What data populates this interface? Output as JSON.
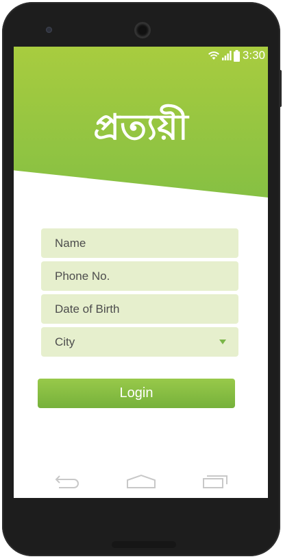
{
  "status_bar": {
    "time": "3:30",
    "icons": [
      "wifi-icon",
      "signal-icon",
      "battery-icon"
    ],
    "color": "#ffffff"
  },
  "header": {
    "app_name": "প্রত্যয়ী",
    "gradient": [
      "#a8cc3f",
      "#86c043"
    ]
  },
  "form": {
    "name_placeholder": "Name",
    "phone_placeholder": "Phone No.",
    "dob_placeholder": "Date of Birth",
    "city_value": "City",
    "field_color": "#e6efcd"
  },
  "login_button": {
    "label": "Login",
    "color": "#86bd42"
  },
  "nav_bar": {
    "icons": [
      "back-icon",
      "home-icon",
      "recent-apps-icon"
    ]
  }
}
